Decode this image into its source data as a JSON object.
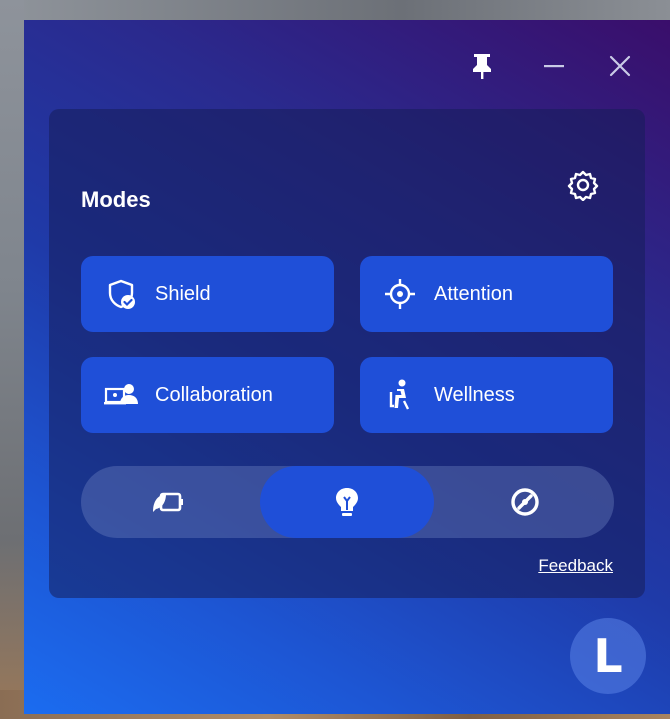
{
  "window": {
    "controls": {
      "pin_icon": "pin-icon",
      "minimize_icon": "minimize-icon",
      "close_icon": "close-icon"
    }
  },
  "panel": {
    "title": "Modes",
    "settings_icon": "gear-icon",
    "modes": [
      {
        "label": "Shield",
        "icon": "shield-check-icon"
      },
      {
        "label": "Attention",
        "icon": "crosshair-icon"
      },
      {
        "label": "Collaboration",
        "icon": "collaboration-icon"
      },
      {
        "label": "Wellness",
        "icon": "seated-person-icon"
      }
    ],
    "power_modes": [
      {
        "icon": "battery-saver-icon",
        "selected": false
      },
      {
        "icon": "lightbulb-icon",
        "selected": true
      },
      {
        "icon": "performance-gauge-icon",
        "selected": false
      }
    ],
    "feedback_label": "Feedback"
  },
  "brand": {
    "logo_letter": "L"
  },
  "colors": {
    "accent": "#1f4fd8",
    "window_gradient_start": "#3a0e6b",
    "window_gradient_end": "#1b6cf0"
  }
}
